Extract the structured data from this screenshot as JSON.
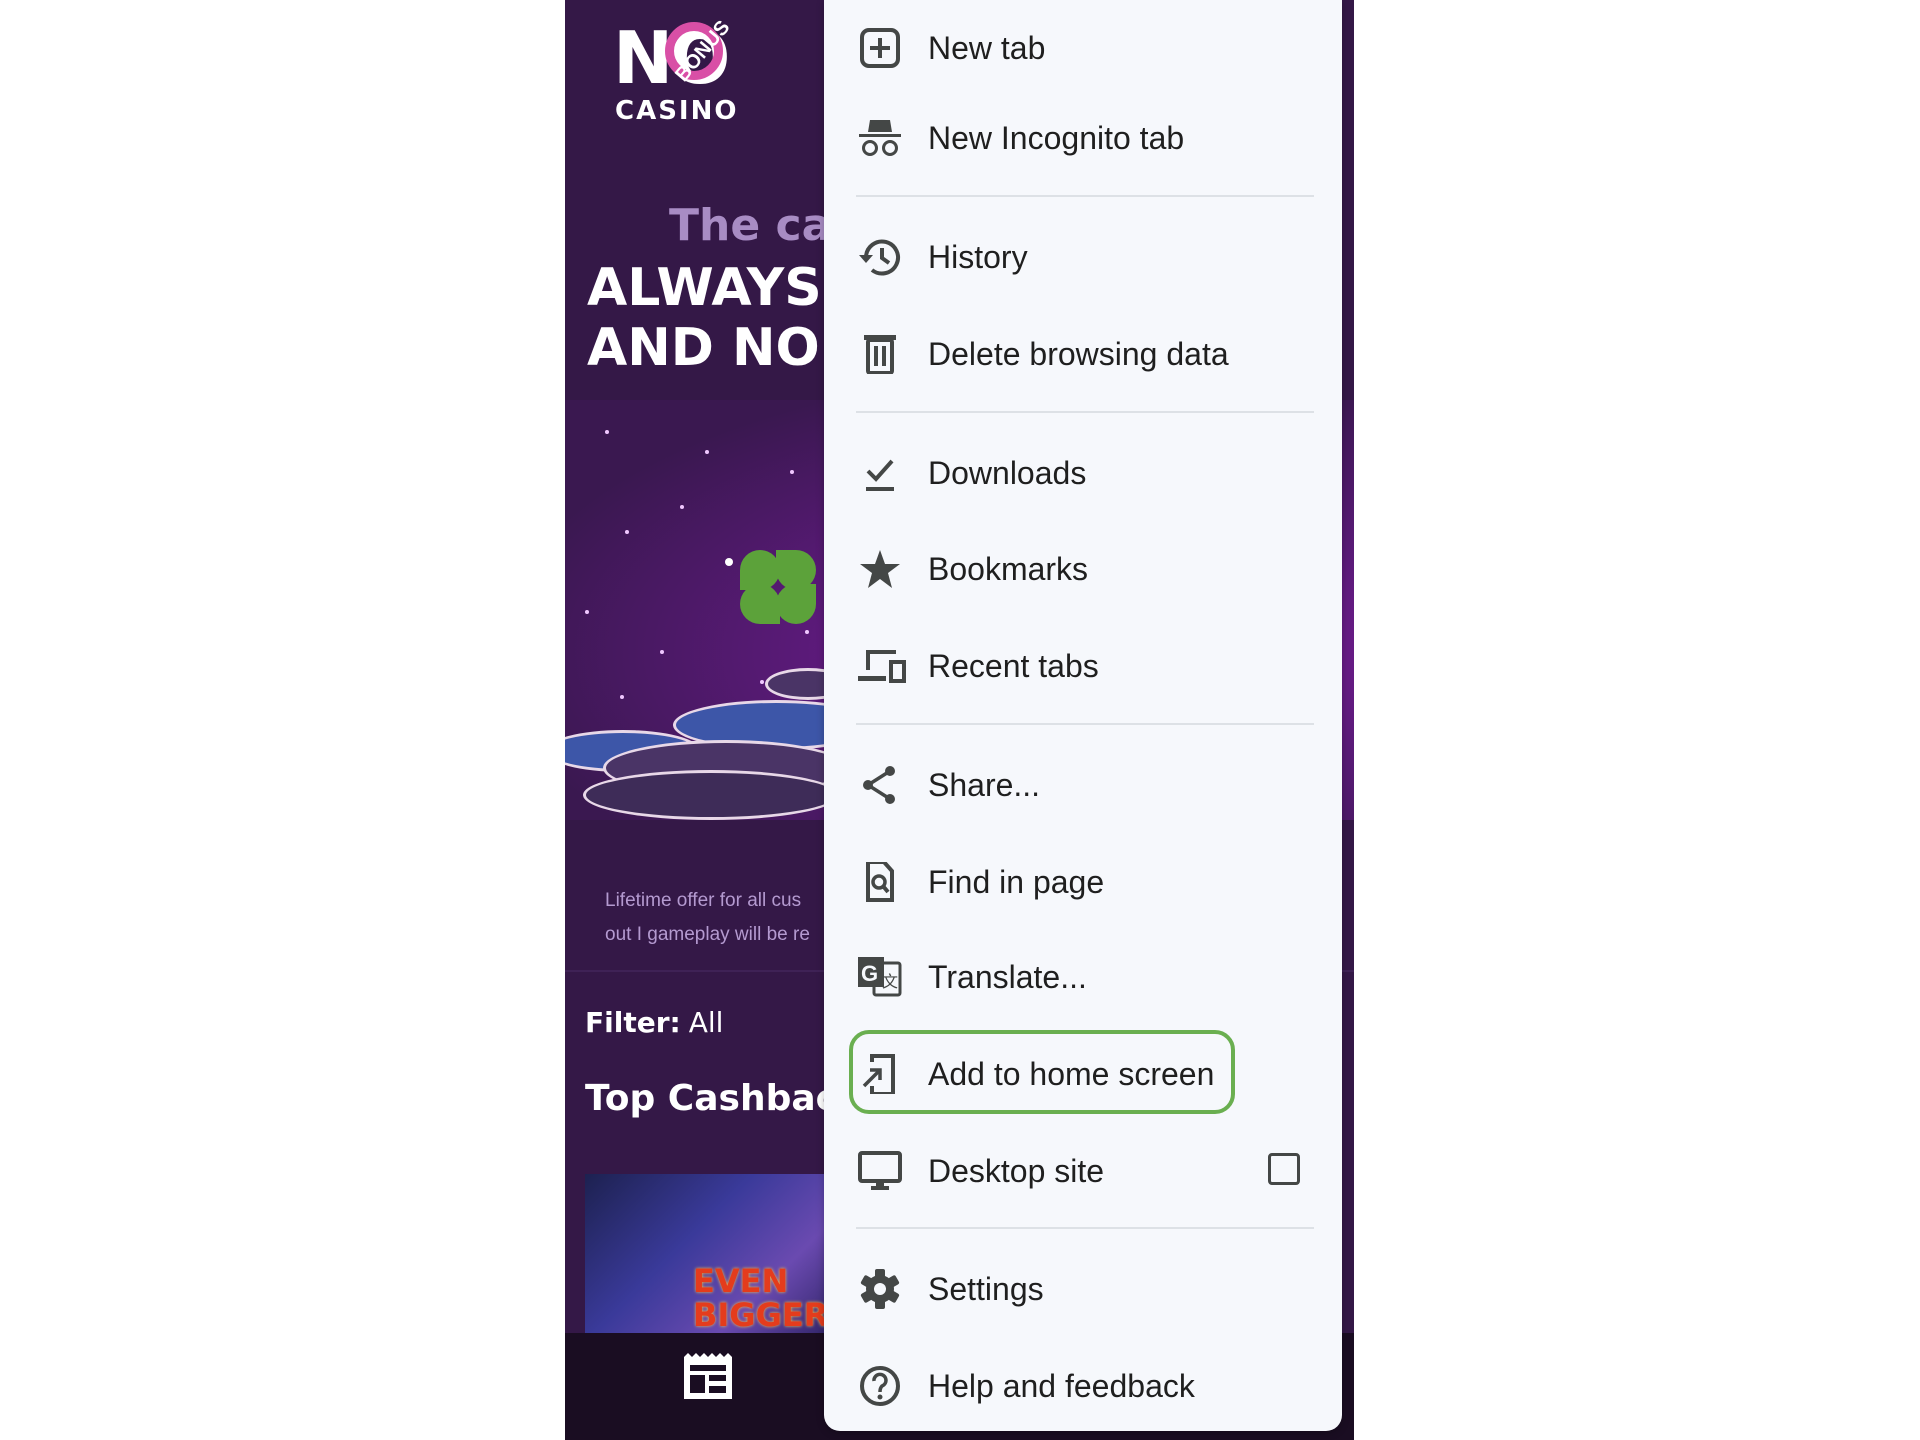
{
  "page": {
    "logo": {
      "no": "NO",
      "bonus": "BONUS",
      "casino": "CASINO"
    },
    "hero_subtitle": "The cas",
    "hero_title_line1": "ALWAYS",
    "hero_title_line2": "AND NO S",
    "offer_line1": "Lifetime offer for all cus",
    "offer_line2": "out I gameplay will be re",
    "filter_label": "Filter:",
    "filter_value": "All",
    "section_title": "Top Cashback",
    "game_thumb_line1": "EVEN",
    "game_thumb_line2": "BIGGER"
  },
  "menu": {
    "items": [
      {
        "label": "New tab",
        "icon": "new-tab-icon"
      },
      {
        "label": "New Incognito tab",
        "icon": "incognito-icon"
      },
      {
        "label": "History",
        "icon": "history-icon"
      },
      {
        "label": "Delete browsing data",
        "icon": "trash-icon"
      },
      {
        "label": "Downloads",
        "icon": "downloads-icon"
      },
      {
        "label": "Bookmarks",
        "icon": "star-icon"
      },
      {
        "label": "Recent tabs",
        "icon": "devices-icon"
      },
      {
        "label": "Share...",
        "icon": "share-icon"
      },
      {
        "label": "Find in page",
        "icon": "find-in-page-icon"
      },
      {
        "label": "Translate...",
        "icon": "translate-icon"
      },
      {
        "label": "Add to home screen",
        "icon": "add-to-home-screen-icon"
      },
      {
        "label": "Desktop site",
        "icon": "desktop-icon",
        "checked": false
      },
      {
        "label": "Settings",
        "icon": "gear-icon"
      },
      {
        "label": "Help and feedback",
        "icon": "help-icon"
      }
    ],
    "highlighted_item": "Add to home screen",
    "highlight_color": "#6aaf50"
  }
}
